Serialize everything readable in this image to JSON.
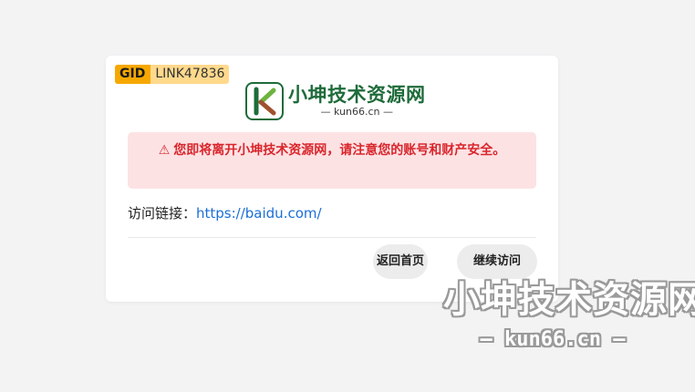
{
  "badge": {
    "label": "GID",
    "value": "LINK47836"
  },
  "logo": {
    "name": "小坤技术资源网",
    "sub": "— kun66.cn —"
  },
  "warning": {
    "text": "您即将离开小坤技术资源网，请注意您的账号和财产安全。"
  },
  "link": {
    "label": "访问链接：",
    "url": "https://baidu.com/"
  },
  "buttons": {
    "home_label": "返回首页",
    "continue_label": "继续访问"
  },
  "watermark": {
    "name": "小坤技术资源网",
    "sub": "— kun66.cn —"
  },
  "colors": {
    "warning_bg": "#fde2e4",
    "warning_text": "#d9262c",
    "link": "#1a6fd6",
    "badge_dark": "#f6a800",
    "badge_light": "#ffd98c",
    "brand_green": "#1e6b3a"
  }
}
